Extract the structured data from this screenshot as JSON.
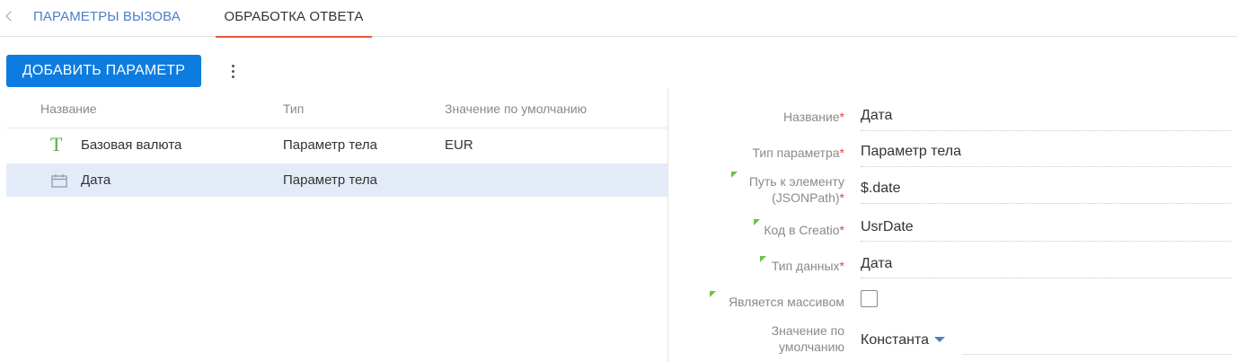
{
  "tabs": {
    "call_params": "ПАРАМЕТРЫ ВЫЗОВА",
    "response_processing": "ОБРАБОТКА ОТВЕТА"
  },
  "toolbar": {
    "add_label": "ДОБАВИТЬ ПАРАМЕТР",
    "more_icon": "vertical-ellipsis-icon"
  },
  "grid": {
    "columns": [
      "Название",
      "Тип",
      "Значение по умолчанию"
    ],
    "rows": [
      {
        "icon": "text-type-icon",
        "name": "Базовая валюта",
        "type": "Параметр тела",
        "default": "EUR"
      },
      {
        "icon": "calendar-icon",
        "name": "Дата",
        "type": "Параметр тела",
        "default": ""
      }
    ]
  },
  "form": {
    "name_label": "Название",
    "name_value": "Дата",
    "param_type_label": "Тип параметра",
    "param_type_value": "Параметр тела",
    "path_label_1": "Путь к элементу",
    "path_label_2": "(JSONPath)",
    "path_value": "$.date",
    "code_label": "Код в Creatio",
    "code_value": "UsrDate",
    "data_type_label": "Тип данных",
    "data_type_value": "Дата",
    "is_array_label": "Является массивом",
    "default_label_1": "Значение по",
    "default_label_2": "умолчанию",
    "default_value": "Константа",
    "required_mark": "*"
  },
  "colors": {
    "accent": "#0d7ce0",
    "active_tab": "#e05a3a",
    "selected_row": "#e4ebf8",
    "required": "#e0473c",
    "hint_marker": "#6cc24a"
  }
}
